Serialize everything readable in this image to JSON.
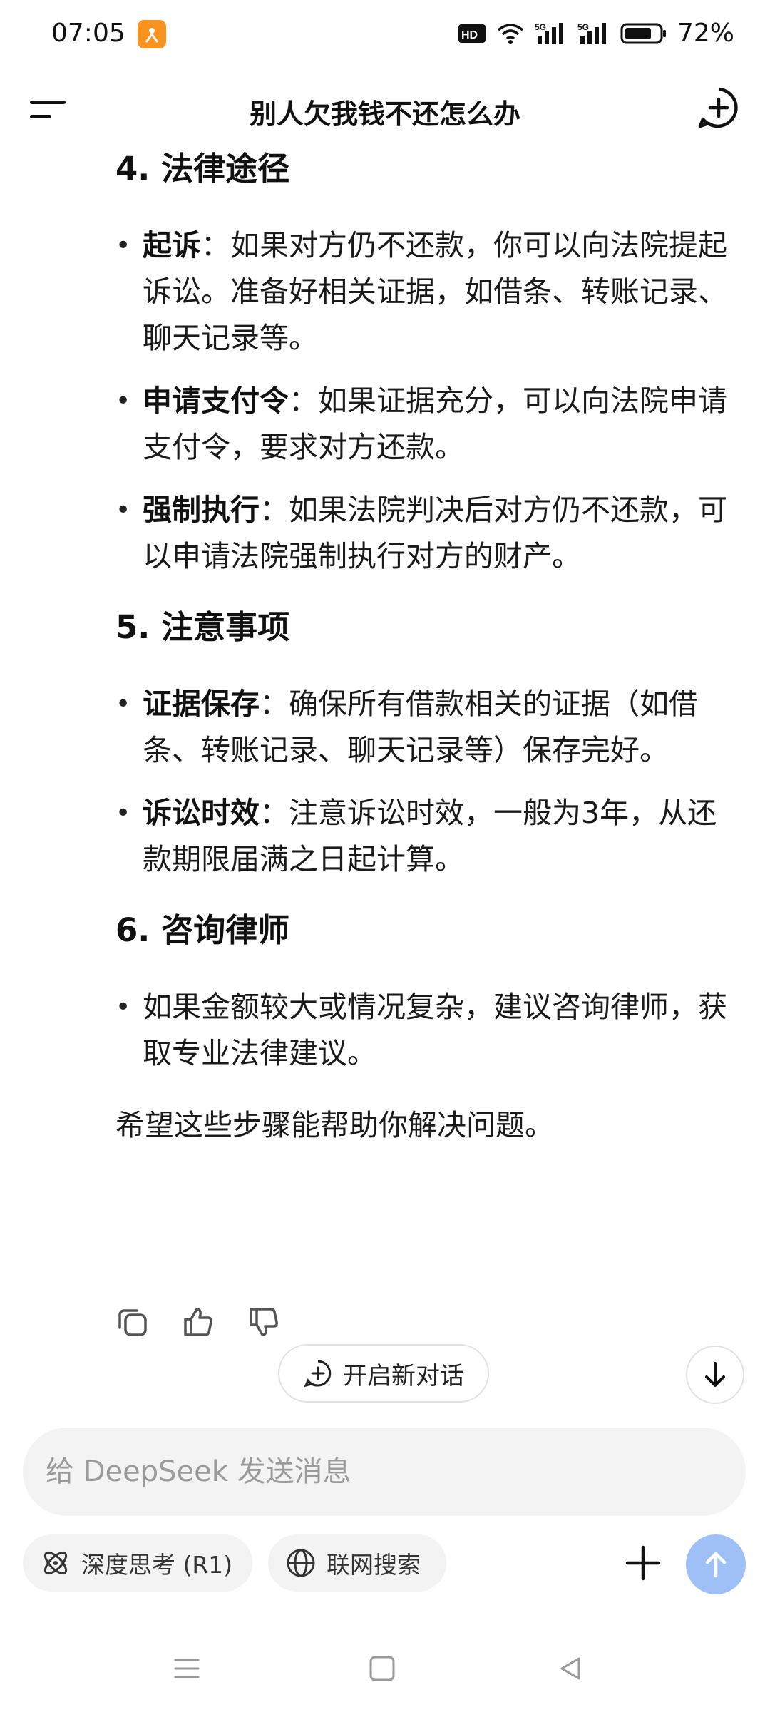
{
  "status_bar": {
    "time": "07:05",
    "battery": "72%",
    "network_labels": [
      "HD",
      "5G",
      "5G"
    ]
  },
  "header": {
    "title": "别人欠我钱不还怎么办"
  },
  "sections": [
    {
      "heading": "4. 法律途径",
      "items": [
        {
          "label": "起诉",
          "text": "：如果对方仍不还款，你可以向法院提起诉讼。准备好相关证据，如借条、转账记录、聊天记录等。"
        },
        {
          "label": "申请支付令",
          "text": "：如果证据充分，可以向法院申请支付令，要求对方还款。"
        },
        {
          "label": "强制执行",
          "text": "：如果法院判决后对方仍不还款，可以申请法院强制执行对方的财产。"
        }
      ]
    },
    {
      "heading": "5. 注意事项",
      "items": [
        {
          "label": "证据保存",
          "text": "：确保所有借款相关的证据（如借条、转账记录、聊天记录等）保存完好。"
        },
        {
          "label": "诉讼时效",
          "text": "：注意诉讼时效，一般为3年，从还款期限届满之日起计算。"
        }
      ]
    },
    {
      "heading": "6. 咨询律师",
      "items": [
        {
          "label": "",
          "text": "如果金额较大或情况复杂，建议咨询律师，获取专业法律建议。"
        }
      ]
    }
  ],
  "conclusion": "希望这些步骤能帮助你解决问题。",
  "new_chat_label": "开启新对话",
  "input": {
    "placeholder": "给 DeepSeek 发送消息",
    "value": ""
  },
  "tools": {
    "deep_think_label": "深度思考 (R1)",
    "web_search_label": "联网搜索"
  },
  "colors": {
    "send_button": "#9ec0f7",
    "chip_bg": "#f3f3f3"
  },
  "icons": [
    "menu-icon",
    "new-chat-icon",
    "copy-icon",
    "thumbs-up-icon",
    "thumbs-down-icon",
    "arrow-down-icon",
    "atom-icon",
    "globe-icon",
    "plus-icon",
    "arrow-up-icon"
  ]
}
